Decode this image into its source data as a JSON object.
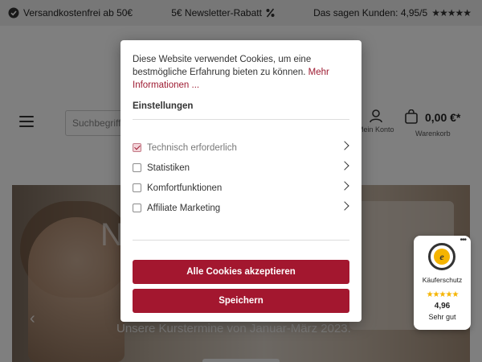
{
  "topbar": {
    "shipping": {
      "icon": "check-circle-icon",
      "text": "Versandkostenfrei ab 50€"
    },
    "newsletter": {
      "text": "5€ Newsletter-Rabatt",
      "icon": "percent-icon"
    },
    "reviews": {
      "text": "Das sagen Kunden: 4,95/5",
      "stars": "★★★★★"
    }
  },
  "header": {
    "search_placeholder": "Suchbegriff",
    "account_label": "Mein Konto",
    "cart_price": "0,00 €*",
    "cart_label": "Warenkorb"
  },
  "hero": {
    "headline": "N                 ür",
    "subtitle": "Unsere Kurstermine von Januar-März 2023.",
    "prev_arrow": "‹"
  },
  "cookie_modal": {
    "intro": "Diese Website verwendet Cookies, um eine bestmögliche Erfahrung bieten zu können.",
    "more_info": "Mehr Informationen ...",
    "settings_title": "Einstellungen",
    "options": [
      {
        "label": "Technisch erforderlich",
        "checked": true
      },
      {
        "label": "Statistiken",
        "checked": false
      },
      {
        "label": "Komfortfunktionen",
        "checked": false
      },
      {
        "label": "Affiliate Marketing",
        "checked": false
      }
    ],
    "accept_all": "Alle Cookies akzeptieren",
    "save": "Speichern"
  },
  "trusted_shops": {
    "dots": "•••",
    "seal_letter": "e",
    "label": "Käuferschutz",
    "stars": "★★★★★",
    "rating": "4,96",
    "quality": "Sehr gut"
  },
  "colors": {
    "accent": "#a3172f",
    "link": "#9e1b32",
    "star_gold": "#f5b400"
  }
}
